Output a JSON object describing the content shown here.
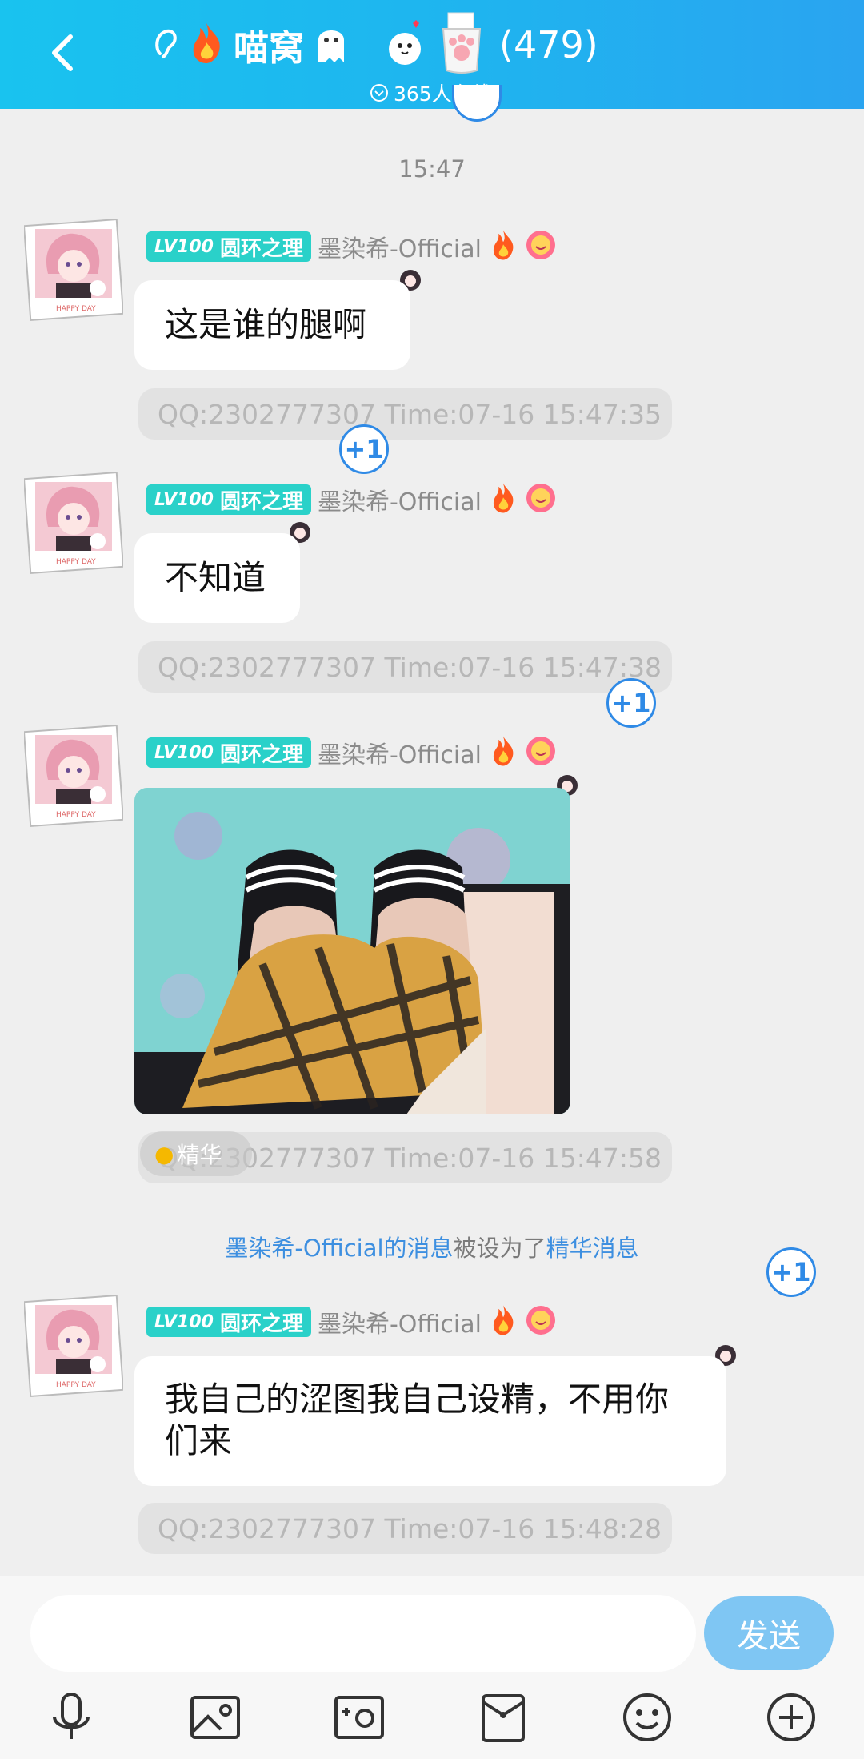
{
  "header": {
    "group_name": "喵窝",
    "member_count": "(479)",
    "online_text": "365人在线"
  },
  "chat": {
    "time_divider": "15:47",
    "messages": [
      {
        "level_tag": "LV100",
        "title": "圆环之理",
        "sender": "墨染希-Official",
        "text": "这是谁的腿啊",
        "meta": "QQ:2302777307  Time:07-16 15:47:35",
        "plus": "+1"
      },
      {
        "level_tag": "LV100",
        "title": "圆环之理",
        "sender": "墨染希-Official",
        "text": "不知道",
        "meta": "QQ:2302777307  Time:07-16 15:47:38",
        "plus": "+1"
      },
      {
        "level_tag": "LV100",
        "title": "圆环之理",
        "sender": "墨染希-Official",
        "essence_tag": "精华",
        "meta": "QQ:2302777307  Time:07-16 15:47:58",
        "plus": "+1"
      },
      {
        "level_tag": "LV100",
        "title": "圆环之理",
        "sender": "墨染希-Official",
        "text": "我自己的涩图我自己设精，不用你们来",
        "meta": "QQ:2302777307  Time:07-16 15:48:28"
      }
    ],
    "system_notice": {
      "sender_link": "墨染希-Official的消息",
      "middle": "被设为了",
      "target_link": "精华消息"
    }
  },
  "input_bar": {
    "input_value": "",
    "send_label": "发送"
  },
  "toolbar": {
    "items": [
      "microphone-icon",
      "image-icon",
      "camera-icon",
      "red-packet-icon",
      "emoji-icon",
      "plus-icon"
    ]
  },
  "colors": {
    "header_start": "#19c3ef",
    "header_end": "#2aa4f0",
    "level_tag": "#2ad1c9",
    "accent_blue": "#2f8ae6",
    "send_button": "#7fc6f3"
  }
}
